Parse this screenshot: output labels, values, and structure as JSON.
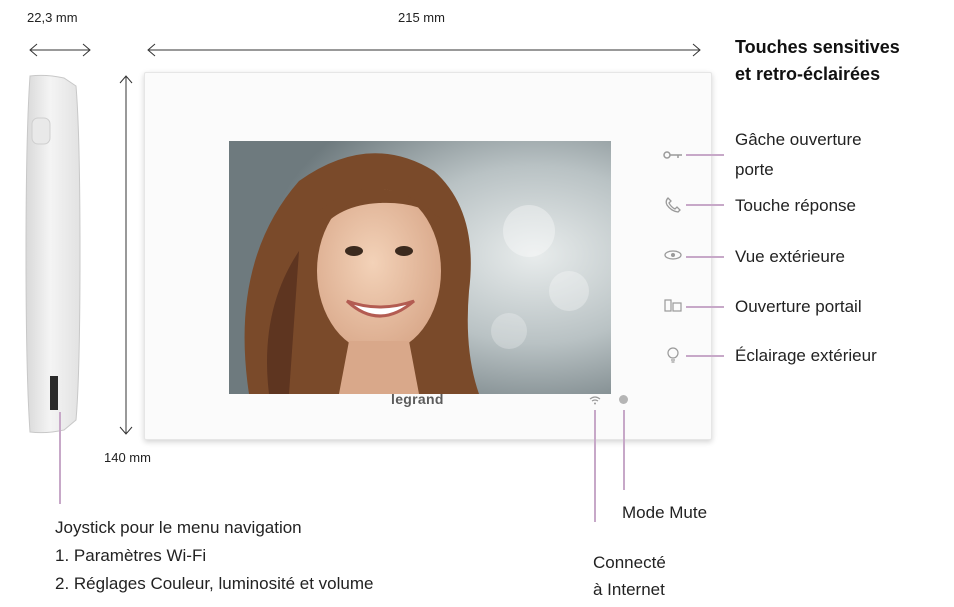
{
  "dimensions": {
    "depth": "22,3 mm",
    "width": "215 mm",
    "height": "140 mm"
  },
  "title_lines": [
    "Touches sensitives",
    "et retro-éclairées"
  ],
  "callouts": {
    "gache_line1": "Gâche ouverture",
    "gache_line2": "porte",
    "reponse": "Touche réponse",
    "vue": "Vue extérieure",
    "portail": "Ouverture portail",
    "eclairage": "Éclairage extérieur",
    "mute": "Mode Mute",
    "connecte_line1": "Connecté",
    "connecte_line2": "à Internet"
  },
  "joystick_lines": [
    "Joystick pour le menu navigation",
    "1. Paramètres Wi-Fi",
    "2. Réglages Couleur, luminosité et volume"
  ],
  "logo": "legrand",
  "icons": {
    "key": "key-icon",
    "phone": "phone-icon",
    "eye": "eye-icon",
    "gate": "gate-icon",
    "bulb": "bulb-icon",
    "wifi": "wifi-icon",
    "mute": "mute-icon"
  },
  "colors": {
    "leader_lines": "#c7a8c8",
    "device_body": "#fbfbfb"
  }
}
